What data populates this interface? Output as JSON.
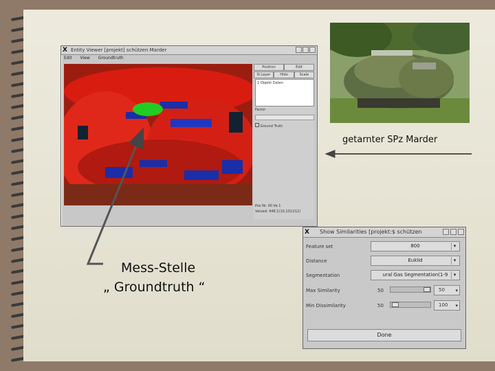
{
  "viewer": {
    "title": "Entity Viewer [projekt] schützen Marder",
    "menu": [
      "Edit",
      "View",
      "Groundtruth"
    ],
    "panel_tabs": [
      "Position",
      "Edit"
    ],
    "panel_subtabs": [
      "N Layer",
      "Hide",
      "Scale"
    ],
    "list_item": "1 Objekt  Daten",
    "factor_label": "Factor",
    "checkbox_label": "Ground Truth",
    "status_line1": "Pos Nr.  00 Ve   1",
    "status_line2": "Valued: 448,1(10,10)(212)"
  },
  "similarities": {
    "title": "Show Similarities [projekt:$ schützen",
    "feature_label": "Feature set",
    "feature_value": "800",
    "distance_label": "Distance",
    "distance_value": "Euklid",
    "segmentation_label": "Segmentation",
    "segmentation_value": "ural Gas Segmentation(1-9",
    "max_label": "Max Similarity",
    "max_slider_value": "50",
    "max_spin": "50",
    "min_label": "Min Dissimilarity",
    "min_slider_value": "50",
    "min_spin": "100",
    "done_label": "Done"
  },
  "caption": "getarnter SPz Marder",
  "callout": {
    "line1": "Mess-Stelle",
    "line2": "„ Groundtruth “"
  },
  "colors": {
    "paper": "#e7e4d2",
    "background": "#8f7a69",
    "highlight_region": "#22cc22"
  }
}
